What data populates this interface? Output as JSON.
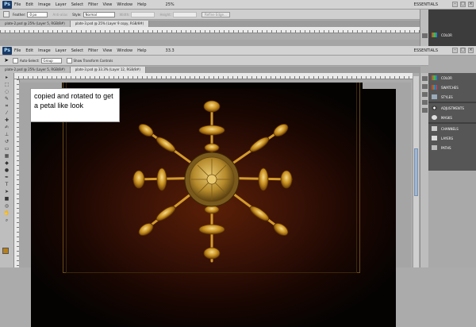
{
  "app": {
    "name": "Photoshop",
    "logo_text": "Ps"
  },
  "menu": {
    "items": [
      "File",
      "Edit",
      "Image",
      "Layer",
      "Select",
      "Filter",
      "View",
      "Window",
      "Help"
    ],
    "zoom": "25%",
    "workspace": "ESSENTIALS"
  },
  "marquee_options": {
    "feather_label": "Feather:",
    "feather_value": "0 px",
    "antialias_label": "Anti-alias",
    "style_label": "Style:",
    "style_value": "Normal",
    "width_label": "Width:",
    "height_label": "Height:",
    "refine_edge": "Refine Edge..."
  },
  "move_options": {
    "auto_select_label": "Auto-Select:",
    "auto_select_value": "Group",
    "show_transform": "Show Transform Controls",
    "zoom": "33.3"
  },
  "document_tabs_top": [
    {
      "label": "plate-2.psd @ 25% (Layer 5, RGB/8#)"
    },
    {
      "label": "plate-3.psd @ 25% (Layer 9 copy, RGB/8#)"
    }
  ],
  "document_tabs_main": [
    {
      "label": "plate-2.psd @ 25% (Layer 5, RGB/8#)"
    },
    {
      "label": "plate-3.psd @ 33.3% (Layer 12, RGB/8#)"
    }
  ],
  "annotation": {
    "text": "copied and rotated to get a petal like look"
  },
  "panels_top": [
    {
      "label": "COLOR",
      "icon": "color-icon"
    }
  ],
  "panels": [
    {
      "label": "COLOR",
      "icon": "color-icon"
    },
    {
      "label": "SWATCHES",
      "icon": "swatches-icon"
    },
    {
      "label": "STYLES",
      "icon": "styles-icon"
    },
    {
      "label": "ADJUSTMENTS",
      "icon": "adjustments-icon"
    },
    {
      "label": "MASKS",
      "icon": "masks-icon"
    },
    {
      "label": "CHANNELS",
      "icon": "channels-icon"
    },
    {
      "label": "LAYERS",
      "icon": "layers-icon"
    },
    {
      "label": "PATHS",
      "icon": "paths-icon"
    }
  ],
  "colors": {
    "foreground": "#b8801a",
    "background": "#ffffff",
    "panel_bg": "#565656"
  }
}
